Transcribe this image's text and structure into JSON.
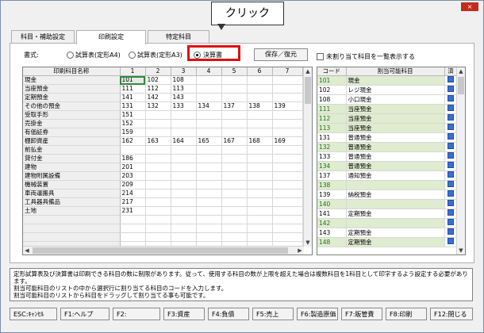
{
  "window": {
    "close_label": "×"
  },
  "callout": {
    "text": "クリック"
  },
  "tabs": [
    {
      "label": "科目・補助設定"
    },
    {
      "label": "印刷設定"
    },
    {
      "label": "特定科目"
    }
  ],
  "form": {
    "label": "書式:",
    "options": [
      {
        "label": "試算表(定形A4)",
        "selected": false
      },
      {
        "label": "試算表(定形A3)",
        "selected": false
      },
      {
        "label": "決算書",
        "selected": true
      }
    ],
    "save_restore_label": "保存／復元",
    "unassigned_checkbox_label": "未割り当て科目を一覧表示する",
    "unassigned_checked": false
  },
  "print_grid": {
    "headers": [
      "印刷科目名称",
      "1",
      "2",
      "3",
      "4",
      "5",
      "6",
      "7"
    ],
    "rows": [
      {
        "name": "現金",
        "cells": [
          "101",
          "102",
          "108",
          "",
          "",
          "",
          ""
        ]
      },
      {
        "name": "当座預金",
        "cells": [
          "111",
          "112",
          "113",
          "",
          "",
          "",
          ""
        ]
      },
      {
        "name": "定期預金",
        "cells": [
          "141",
          "142",
          "143",
          "",
          "",
          "",
          ""
        ]
      },
      {
        "name": "その他の預金",
        "cells": [
          "131",
          "132",
          "133",
          "134",
          "137",
          "138",
          "139"
        ]
      },
      {
        "name": "受取手形",
        "cells": [
          "151",
          "",
          "",
          "",
          "",
          "",
          ""
        ]
      },
      {
        "name": "売掛金",
        "cells": [
          "152",
          "",
          "",
          "",
          "",
          "",
          ""
        ]
      },
      {
        "name": "有価証券",
        "cells": [
          "159",
          "",
          "",
          "",
          "",
          "",
          ""
        ]
      },
      {
        "name": "棚卸資産",
        "cells": [
          "162",
          "163",
          "164",
          "165",
          "167",
          "168",
          "169"
        ]
      },
      {
        "name": "前払金",
        "cells": [
          "",
          "",
          "",
          "",
          "",
          "",
          ""
        ]
      },
      {
        "name": "貸付金",
        "cells": [
          "186",
          "",
          "",
          "",
          "",
          "",
          ""
        ]
      },
      {
        "name": "建物",
        "cells": [
          "201",
          "",
          "",
          "",
          "",
          "",
          ""
        ]
      },
      {
        "name": "建物附属設備",
        "cells": [
          "203",
          "",
          "",
          "",
          "",
          "",
          ""
        ]
      },
      {
        "name": "機械装置",
        "cells": [
          "209",
          "",
          "",
          "",
          "",
          "",
          ""
        ]
      },
      {
        "name": "車両運搬具",
        "cells": [
          "214",
          "",
          "",
          "",
          "",
          "",
          ""
        ]
      },
      {
        "name": "工具器具備品",
        "cells": [
          "217",
          "",
          "",
          "",
          "",
          "",
          ""
        ]
      },
      {
        "name": "土地",
        "cells": [
          "231",
          "",
          "",
          "",
          "",
          "",
          ""
        ]
      },
      {
        "name": "",
        "cells": [
          "",
          "",
          "",
          "",
          "",
          "",
          ""
        ]
      },
      {
        "name": "",
        "cells": [
          "",
          "",
          "",
          "",
          "",
          "",
          ""
        ]
      },
      {
        "name": "",
        "cells": [
          "",
          "",
          "",
          "",
          "",
          "",
          ""
        ]
      },
      {
        "name": "",
        "cells": [
          "",
          "",
          "",
          "",
          "",
          "",
          ""
        ]
      }
    ]
  },
  "assign_grid": {
    "headers": [
      "コード",
      "割当可能科目",
      "済"
    ],
    "rows": [
      {
        "code": "101",
        "name": "現金",
        "green": true
      },
      {
        "code": "102",
        "name": "レジ現金",
        "green": false
      },
      {
        "code": "108",
        "name": "小口現金",
        "green": false
      },
      {
        "code": "111",
        "name": "当座預金",
        "green": true
      },
      {
        "code": "112",
        "name": "当座預金",
        "green": true
      },
      {
        "code": "113",
        "name": "当座預金",
        "green": true
      },
      {
        "code": "131",
        "name": "普通預金",
        "green": false
      },
      {
        "code": "132",
        "name": "普通預金",
        "green": true
      },
      {
        "code": "133",
        "name": "普通預金",
        "green": false
      },
      {
        "code": "134",
        "name": "普通預金",
        "green": true
      },
      {
        "code": "137",
        "name": "通知預金",
        "green": false
      },
      {
        "code": "138",
        "name": "",
        "green": true
      },
      {
        "code": "139",
        "name": "納税預金",
        "green": false
      },
      {
        "code": "140",
        "name": "",
        "green": true
      },
      {
        "code": "141",
        "name": "定期預金",
        "green": false
      },
      {
        "code": "142",
        "name": "",
        "green": true
      },
      {
        "code": "143",
        "name": "定期預金",
        "green": false
      },
      {
        "code": "148",
        "name": "定期預金",
        "green": true
      }
    ]
  },
  "notes": [
    "定形試算表及び決算書は印刷できる科目の数に制限があります。従って、使用する科目の数が上限を超えた場合は複数科目を1科目として印字するよう設定する必要があります。",
    "割当可能科目のリストの中から選択行に割り当てる科目のコードを入力します。",
    "割当可能科目のリストから科目をドラッグして割り当てる事も可能です。"
  ],
  "fkeys": [
    {
      "label": "ESC:ｷｬﾝｾﾙ"
    },
    {
      "label": "F1:ヘルプ"
    },
    {
      "label": "F2:"
    },
    {
      "label": "F3:資産"
    },
    {
      "label": "F4:負債"
    },
    {
      "label": "F5:売上"
    },
    {
      "label": "F6:製造原価"
    },
    {
      "label": "F7:販管費"
    },
    {
      "label": "F8:印刷"
    },
    {
      "label": "F12:閉じる"
    }
  ],
  "colors": {
    "highlight": "#e01010",
    "green_row": "#dfeccf",
    "selected_cell_border": "#2e8b3a"
  }
}
